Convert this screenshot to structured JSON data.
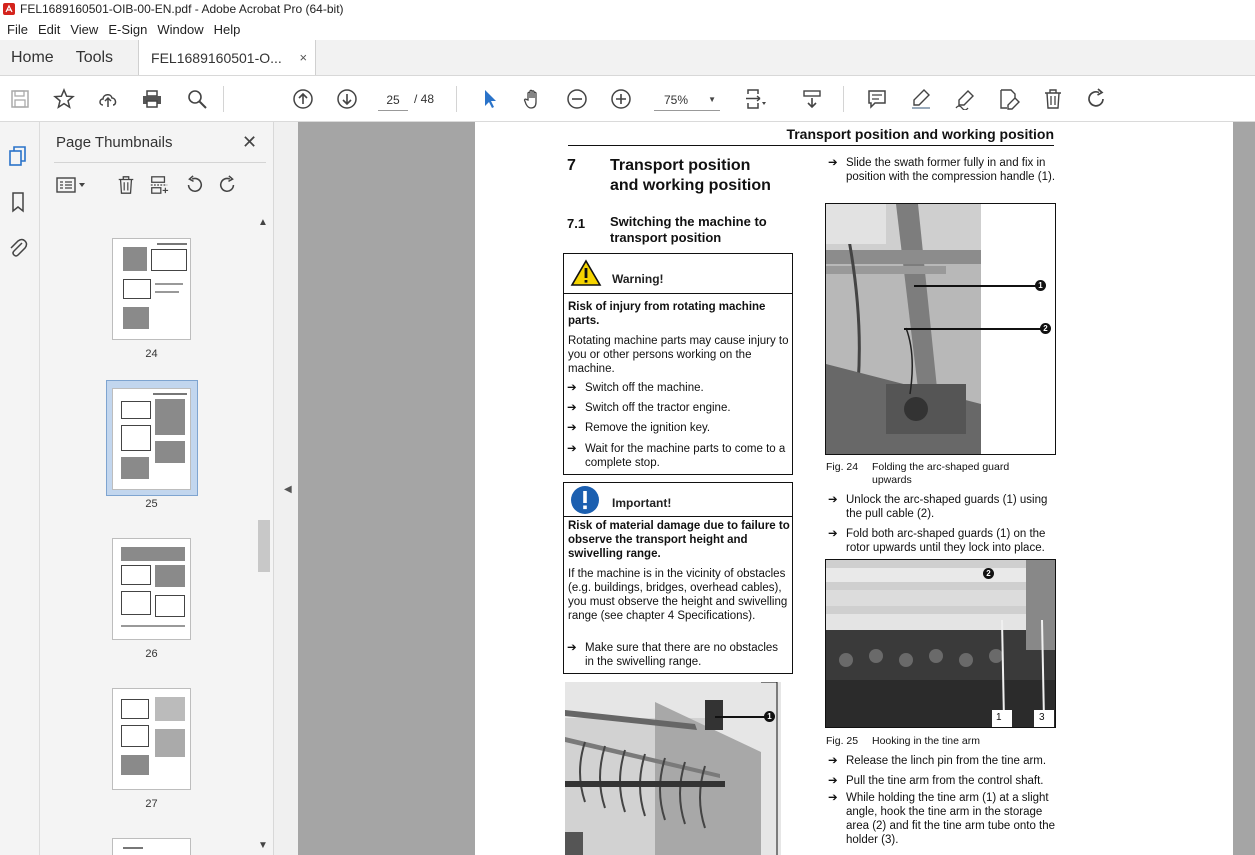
{
  "window": {
    "title": "FEL1689160501-OIB-00-EN.pdf - Adobe Acrobat Pro (64-bit)"
  },
  "menu": [
    "File",
    "Edit",
    "View",
    "E-Sign",
    "Window",
    "Help"
  ],
  "tabs": {
    "home": "Home",
    "tools": "Tools",
    "document": "FEL1689160501-O...",
    "close_glyph": "×"
  },
  "toolbar": {
    "current_page": "25",
    "page_total": "/ 48",
    "zoom": "75%",
    "icons": [
      "save-icon",
      "star-icon",
      "upload-icon",
      "print-icon",
      "search-icon",
      "page-up-icon",
      "page-down-icon",
      "select-cursor-icon",
      "hand-icon",
      "zoom-out-icon",
      "zoom-in-icon",
      "page-fit-icon",
      "scroll-mode-icon",
      "comment-icon",
      "highlight-icon",
      "sign-icon",
      "edit-pdf-icon",
      "delete-icon",
      "rotate-icon"
    ]
  },
  "thumbnails": {
    "header": "Page Thumbnails",
    "close_glyph": "✕",
    "pages": [
      {
        "label": "24",
        "selected": false
      },
      {
        "label": "25",
        "selected": true
      },
      {
        "label": "26",
        "selected": false
      },
      {
        "label": "27",
        "selected": false
      }
    ]
  },
  "document": {
    "running_header": "Transport position and working position",
    "chapter_number": "7",
    "chapter_title_line1": "Transport position",
    "chapter_title_line2": "and working position",
    "section_number": "7.1",
    "section_title_line1": "Switching the machine to",
    "section_title_line2": "transport position",
    "warning": {
      "title": "Warning!",
      "lead": "Risk of injury from rotating machine parts.",
      "body": "Rotating machine parts may cause injury to you or other persons working on the machine.",
      "steps": [
        "Switch off the machine.",
        "Switch off the tractor engine.",
        "Remove the ignition key.",
        "Wait for the machine parts to come to a complete stop."
      ]
    },
    "important": {
      "title": "Important!",
      "lead": "Risk of material damage due to failure to observe the transport height and swivelling range.",
      "body": "If the machine is in the vicinity of obstacles (e.g. buildings, bridges, overhead cables), you must observe the height and swivelling range (see chapter 4 Specifications).",
      "steps": [
        "Make sure that there are no obstacles in the swivelling range."
      ]
    },
    "right_intro": "Slide the swath former fully in and fix in position with the compression handle (1).",
    "fig24": {
      "number": "Fig. 24",
      "caption": "Folding the arc-shaped guard upwards",
      "callouts": [
        "1",
        "2"
      ]
    },
    "steps_after_fig24": [
      "Unlock the arc-shaped guards (1) using the pull cable (2).",
      "Fold both arc-shaped guards (1) on the rotor upwards until they lock into place."
    ],
    "fig25": {
      "number": "Fig. 25",
      "caption": "Hooking in the tine arm",
      "callouts": [
        "2",
        "1",
        "3"
      ]
    },
    "steps_after_fig25": [
      "Release the linch pin from the tine arm.",
      "Pull the tine arm from the control shaft.",
      "While holding the tine arm (1) at a slight angle, hook the tine arm in the storage area (2) and fit the tine arm tube onto the holder (3)."
    ],
    "bottom_fig_callouts": [
      "1"
    ]
  },
  "glyphs": {
    "arrow": "➔",
    "collapse": "◀",
    "scroll_up": "▲",
    "scroll_down": "▼"
  }
}
